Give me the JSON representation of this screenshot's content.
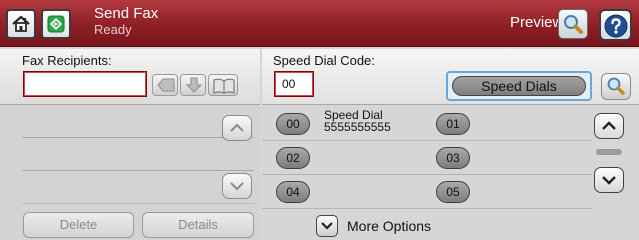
{
  "header": {
    "title": "Send Fax",
    "status": "Ready",
    "preview_label": "Preview",
    "home_icon": "home-icon",
    "start_icon": "start-fax-icon",
    "preview_icon": "magnifier-icon",
    "help_icon": "help-icon",
    "accent": "#9b2a30"
  },
  "left": {
    "recipients_label": "Fax Recipients:",
    "recipients_value": "",
    "delete_label": "Delete",
    "details_label": "Details"
  },
  "right": {
    "code_label": "Speed Dial Code:",
    "code_value": "00",
    "speed_dials_label": "Speed Dials",
    "dials": [
      {
        "code": "00",
        "name": "Speed Dial",
        "number": "5555555555"
      },
      {
        "code": "01",
        "name": "",
        "number": ""
      },
      {
        "code": "02",
        "name": "",
        "number": ""
      },
      {
        "code": "03",
        "name": "",
        "number": ""
      },
      {
        "code": "04",
        "name": "",
        "number": ""
      },
      {
        "code": "05",
        "name": "",
        "number": ""
      }
    ],
    "more_options_label": "More Options"
  }
}
